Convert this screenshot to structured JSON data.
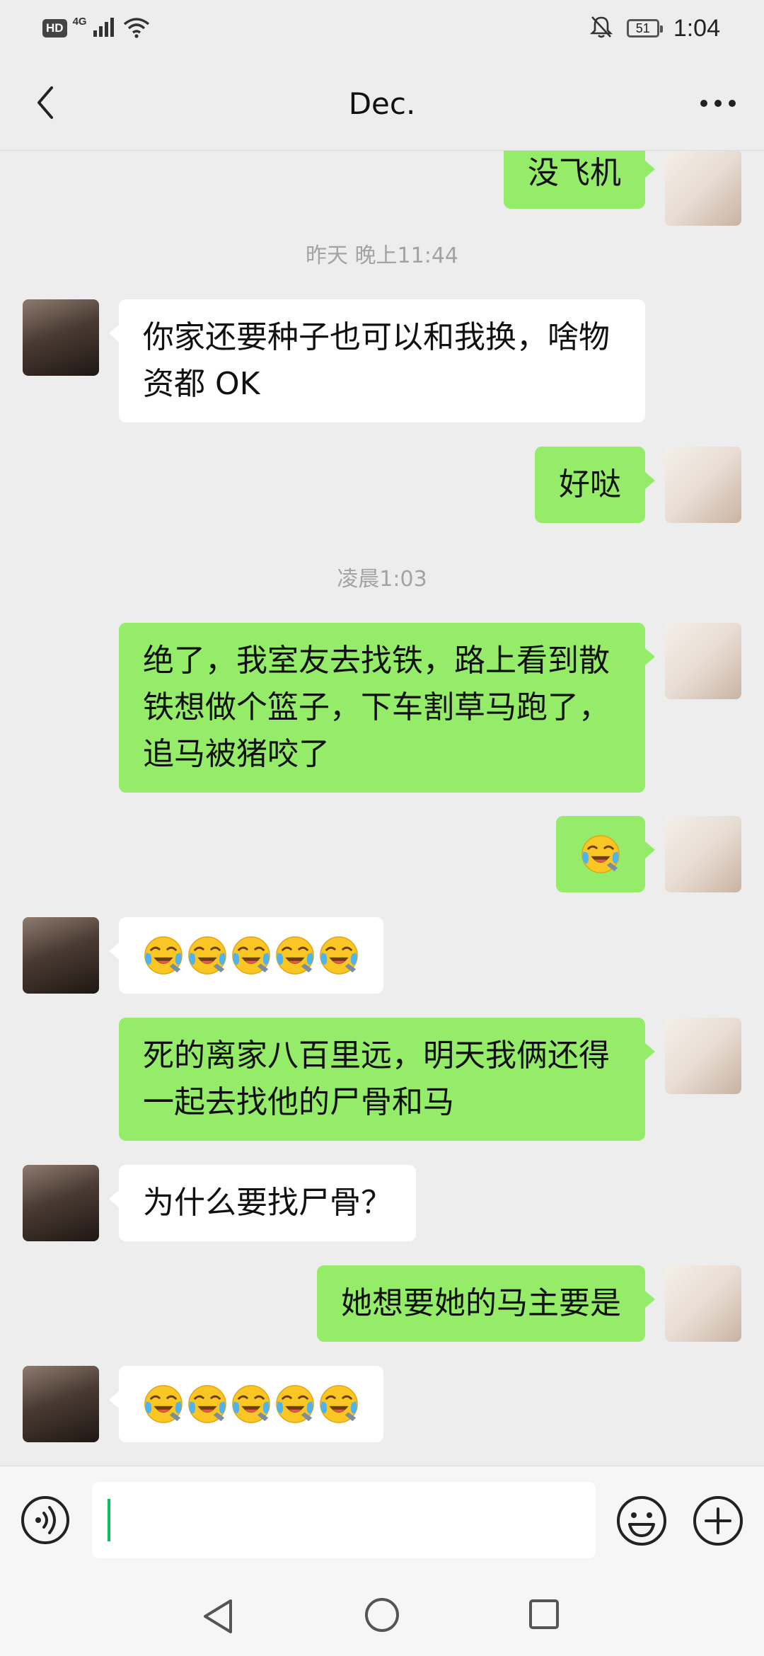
{
  "status_bar": {
    "hd": "HD",
    "network": "4G",
    "battery": "51",
    "time": "1:04"
  },
  "title_bar": {
    "title": "Dec.",
    "back_icon": "chevron-left-icon",
    "more_icon": "more-dots-icon"
  },
  "messages": [
    {
      "sender": "me",
      "text": "没飞机"
    },
    {
      "timestamp": "昨天 晚上11:44"
    },
    {
      "sender": "friend",
      "lines": [
        "你家还要种子也可以和我换，啥物",
        "资都 OK"
      ]
    },
    {
      "sender": "me",
      "text": "好哒"
    },
    {
      "timestamp": "凌晨1:03"
    },
    {
      "sender": "me",
      "lines": [
        "绝了，我室友去找铁，路上看到散",
        "铁想做个篮子，下车割草马跑了，",
        "追马被猪咬了"
      ]
    },
    {
      "sender": "me",
      "emoji": "loudly-crying-laughing-emoji",
      "emoji_count": 1
    },
    {
      "sender": "friend",
      "emoji": "loudly-crying-laughing-emoji",
      "emoji_count": 5
    },
    {
      "sender": "me",
      "lines": [
        "死的离家八百里远，明天我俩还得",
        "一起去找他的尸骨和马"
      ]
    },
    {
      "sender": "friend",
      "text": "为什么要找尸骨？"
    },
    {
      "sender": "me",
      "text": "她想要她的马主要是"
    },
    {
      "sender": "friend",
      "emoji": "loudly-crying-laughing-emoji",
      "emoji_count": 5
    }
  ],
  "input_bar": {
    "voice_icon": "voice-icon",
    "input_value": "",
    "emoji_icon": "emoji-icon",
    "plus_icon": "plus-icon"
  },
  "nav_bar": {
    "back_icon": "nav-back-icon",
    "home_icon": "nav-home-icon",
    "recent_icon": "nav-recent-icon"
  },
  "colors": {
    "background": "#ededed",
    "my_bubble": "#95ec69",
    "friend_bubble": "#ffffff",
    "cursor": "#07c160"
  }
}
